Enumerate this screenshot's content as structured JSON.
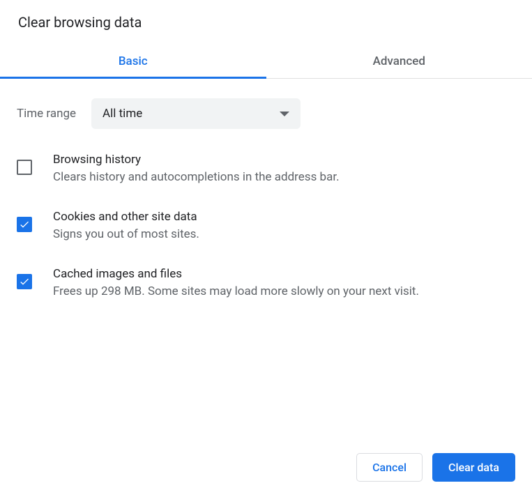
{
  "title": "Clear browsing data",
  "tabs": {
    "basic": "Basic",
    "advanced": "Advanced"
  },
  "time_range": {
    "label": "Time range",
    "value": "All time"
  },
  "options": [
    {
      "title": "Browsing history",
      "subtitle": "Clears history and autocompletions in the address bar.",
      "checked": false
    },
    {
      "title": "Cookies and other site data",
      "subtitle": "Signs you out of most sites.",
      "checked": true
    },
    {
      "title": "Cached images and files",
      "subtitle": "Frees up 298 MB. Some sites may load more slowly on your next visit.",
      "checked": true
    }
  ],
  "buttons": {
    "cancel": "Cancel",
    "clear": "Clear data"
  }
}
